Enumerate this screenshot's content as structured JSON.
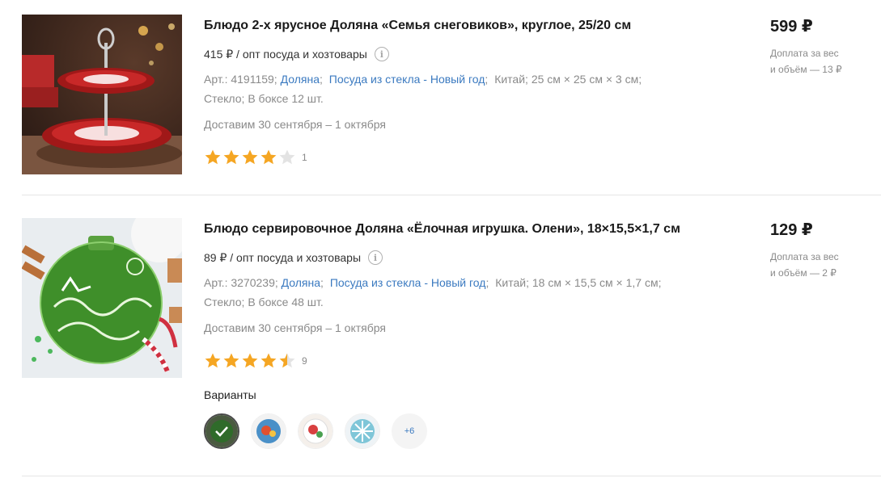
{
  "products": [
    {
      "title": "Блюдо 2-х ярусное Доляна «Семья снеговиков», круглое, 25/20 см",
      "opt_price": "415 ₽ / опт посуда и хозтовары",
      "article": "Арт.: 4191159;",
      "brand": "Доляна",
      "category": "Посуда из стекла - Новый год",
      "country": "Китай;",
      "size": "25 см × 25 см × 3 см;",
      "material": "Стекло;",
      "box": "В боксе 12 шт.",
      "delivery": "Доставим 30 сентября – 1 октября",
      "rating": 4,
      "rating_count": "1",
      "price": "599 ₽",
      "surcharge_line1": "Доплата за вес",
      "surcharge_line2": "и объём — 13 ₽",
      "image_icon": "tiered-dish-image"
    },
    {
      "title": "Блюдо сервировочное Доляна «Ёлочная игрушка. Олени», 18×15,5×1,7 см",
      "opt_price": "89 ₽ / опт посуда и хозтовары",
      "article": "Арт.: 3270239;",
      "brand": "Доляна",
      "category": "Посуда из стекла - Новый год",
      "country": "Китай;",
      "size": "18 см × 15,5 см × 1,7 см;",
      "material": "Стекло;",
      "box": "В боксе 48 шт.",
      "delivery": "Доставим 30 сентября – 1 октября",
      "rating": 4.5,
      "rating_count": "9",
      "price": "129 ₽",
      "surcharge_line1": "Доплата за вес",
      "surcharge_line2": "и объём — 2 ₽",
      "image_icon": "green-plate-image",
      "variants_label": "Варианты",
      "variants_more": "+6"
    }
  ],
  "colors": {
    "link": "#3b7ac0",
    "star": "#f5a623",
    "star_empty": "#e3e3e3",
    "muted": "#8a8a8a"
  }
}
